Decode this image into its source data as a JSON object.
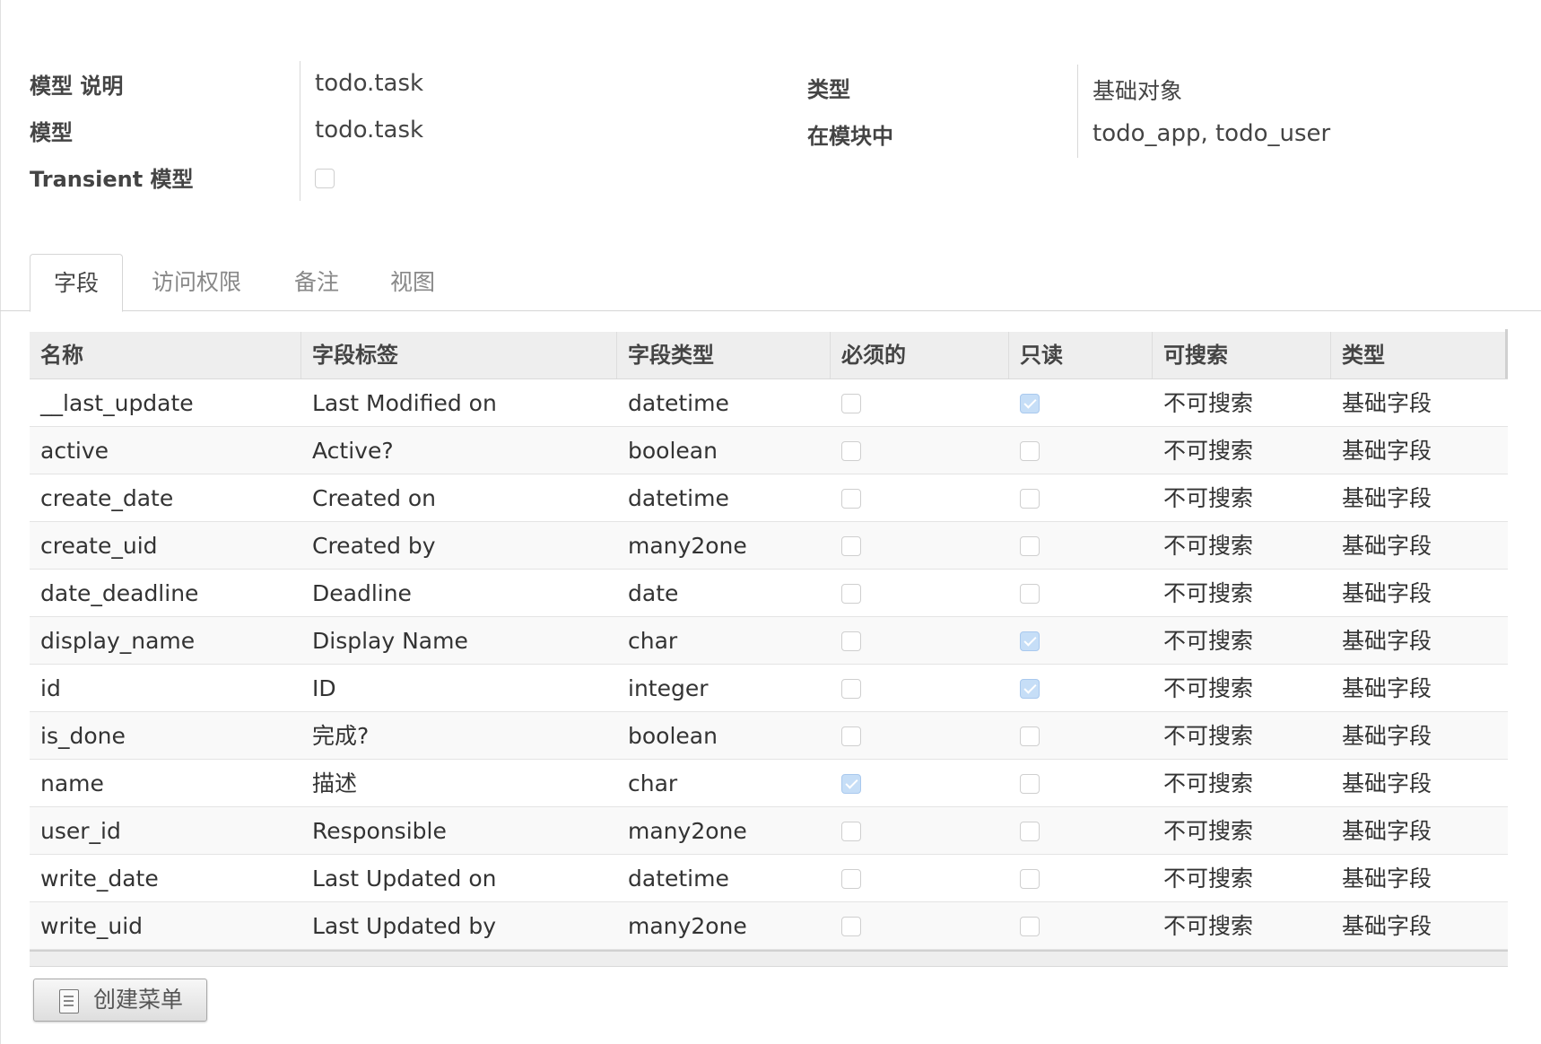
{
  "header": {
    "model_desc_label": "模型 说明",
    "model_desc_value": "todo.task",
    "model_label": "模型",
    "model_value": "todo.task",
    "transient_label": "Transient 模型",
    "transient_checked": false,
    "type_label": "类型",
    "type_value": "基础对象",
    "in_modules_label": "在模块中",
    "in_modules_value": "todo_app, todo_user"
  },
  "tabs": [
    {
      "label": "字段",
      "active": true
    },
    {
      "label": "访问权限",
      "active": false
    },
    {
      "label": "备注",
      "active": false
    },
    {
      "label": "视图",
      "active": false
    }
  ],
  "table": {
    "columns": [
      "名称",
      "字段标签",
      "字段类型",
      "必须的",
      "只读",
      "可搜索",
      "类型"
    ],
    "rows": [
      {
        "name": "__last_update",
        "label": "Last Modified on",
        "ftype": "datetime",
        "required": false,
        "readonly": true,
        "searchable": "不可搜索",
        "kind": "基础字段"
      },
      {
        "name": "active",
        "label": "Active?",
        "ftype": "boolean",
        "required": false,
        "readonly": false,
        "searchable": "不可搜索",
        "kind": "基础字段"
      },
      {
        "name": "create_date",
        "label": "Created on",
        "ftype": "datetime",
        "required": false,
        "readonly": false,
        "searchable": "不可搜索",
        "kind": "基础字段"
      },
      {
        "name": "create_uid",
        "label": "Created by",
        "ftype": "many2one",
        "required": false,
        "readonly": false,
        "searchable": "不可搜索",
        "kind": "基础字段"
      },
      {
        "name": "date_deadline",
        "label": "Deadline",
        "ftype": "date",
        "required": false,
        "readonly": false,
        "searchable": "不可搜索",
        "kind": "基础字段"
      },
      {
        "name": "display_name",
        "label": "Display Name",
        "ftype": "char",
        "required": false,
        "readonly": true,
        "searchable": "不可搜索",
        "kind": "基础字段"
      },
      {
        "name": "id",
        "label": "ID",
        "ftype": "integer",
        "required": false,
        "readonly": true,
        "searchable": "不可搜索",
        "kind": "基础字段"
      },
      {
        "name": "is_done",
        "label": "完成?",
        "ftype": "boolean",
        "required": false,
        "readonly": false,
        "searchable": "不可搜索",
        "kind": "基础字段"
      },
      {
        "name": "name",
        "label": "描述",
        "ftype": "char",
        "required": true,
        "readonly": false,
        "searchable": "不可搜索",
        "kind": "基础字段"
      },
      {
        "name": "user_id",
        "label": "Responsible",
        "ftype": "many2one",
        "required": false,
        "readonly": false,
        "searchable": "不可搜索",
        "kind": "基础字段"
      },
      {
        "name": "write_date",
        "label": "Last Updated on",
        "ftype": "datetime",
        "required": false,
        "readonly": false,
        "searchable": "不可搜索",
        "kind": "基础字段"
      },
      {
        "name": "write_uid",
        "label": "Last Updated by",
        "ftype": "many2one",
        "required": false,
        "readonly": false,
        "searchable": "不可搜索",
        "kind": "基础字段"
      }
    ]
  },
  "footer": {
    "create_menu_label": "创建菜单",
    "create_menu_icon": "document-icon"
  },
  "colors": {
    "checked_fill": "#c6def7",
    "header_bg": "#eeeeee",
    "alt_row_bg": "#f9f9f9"
  }
}
